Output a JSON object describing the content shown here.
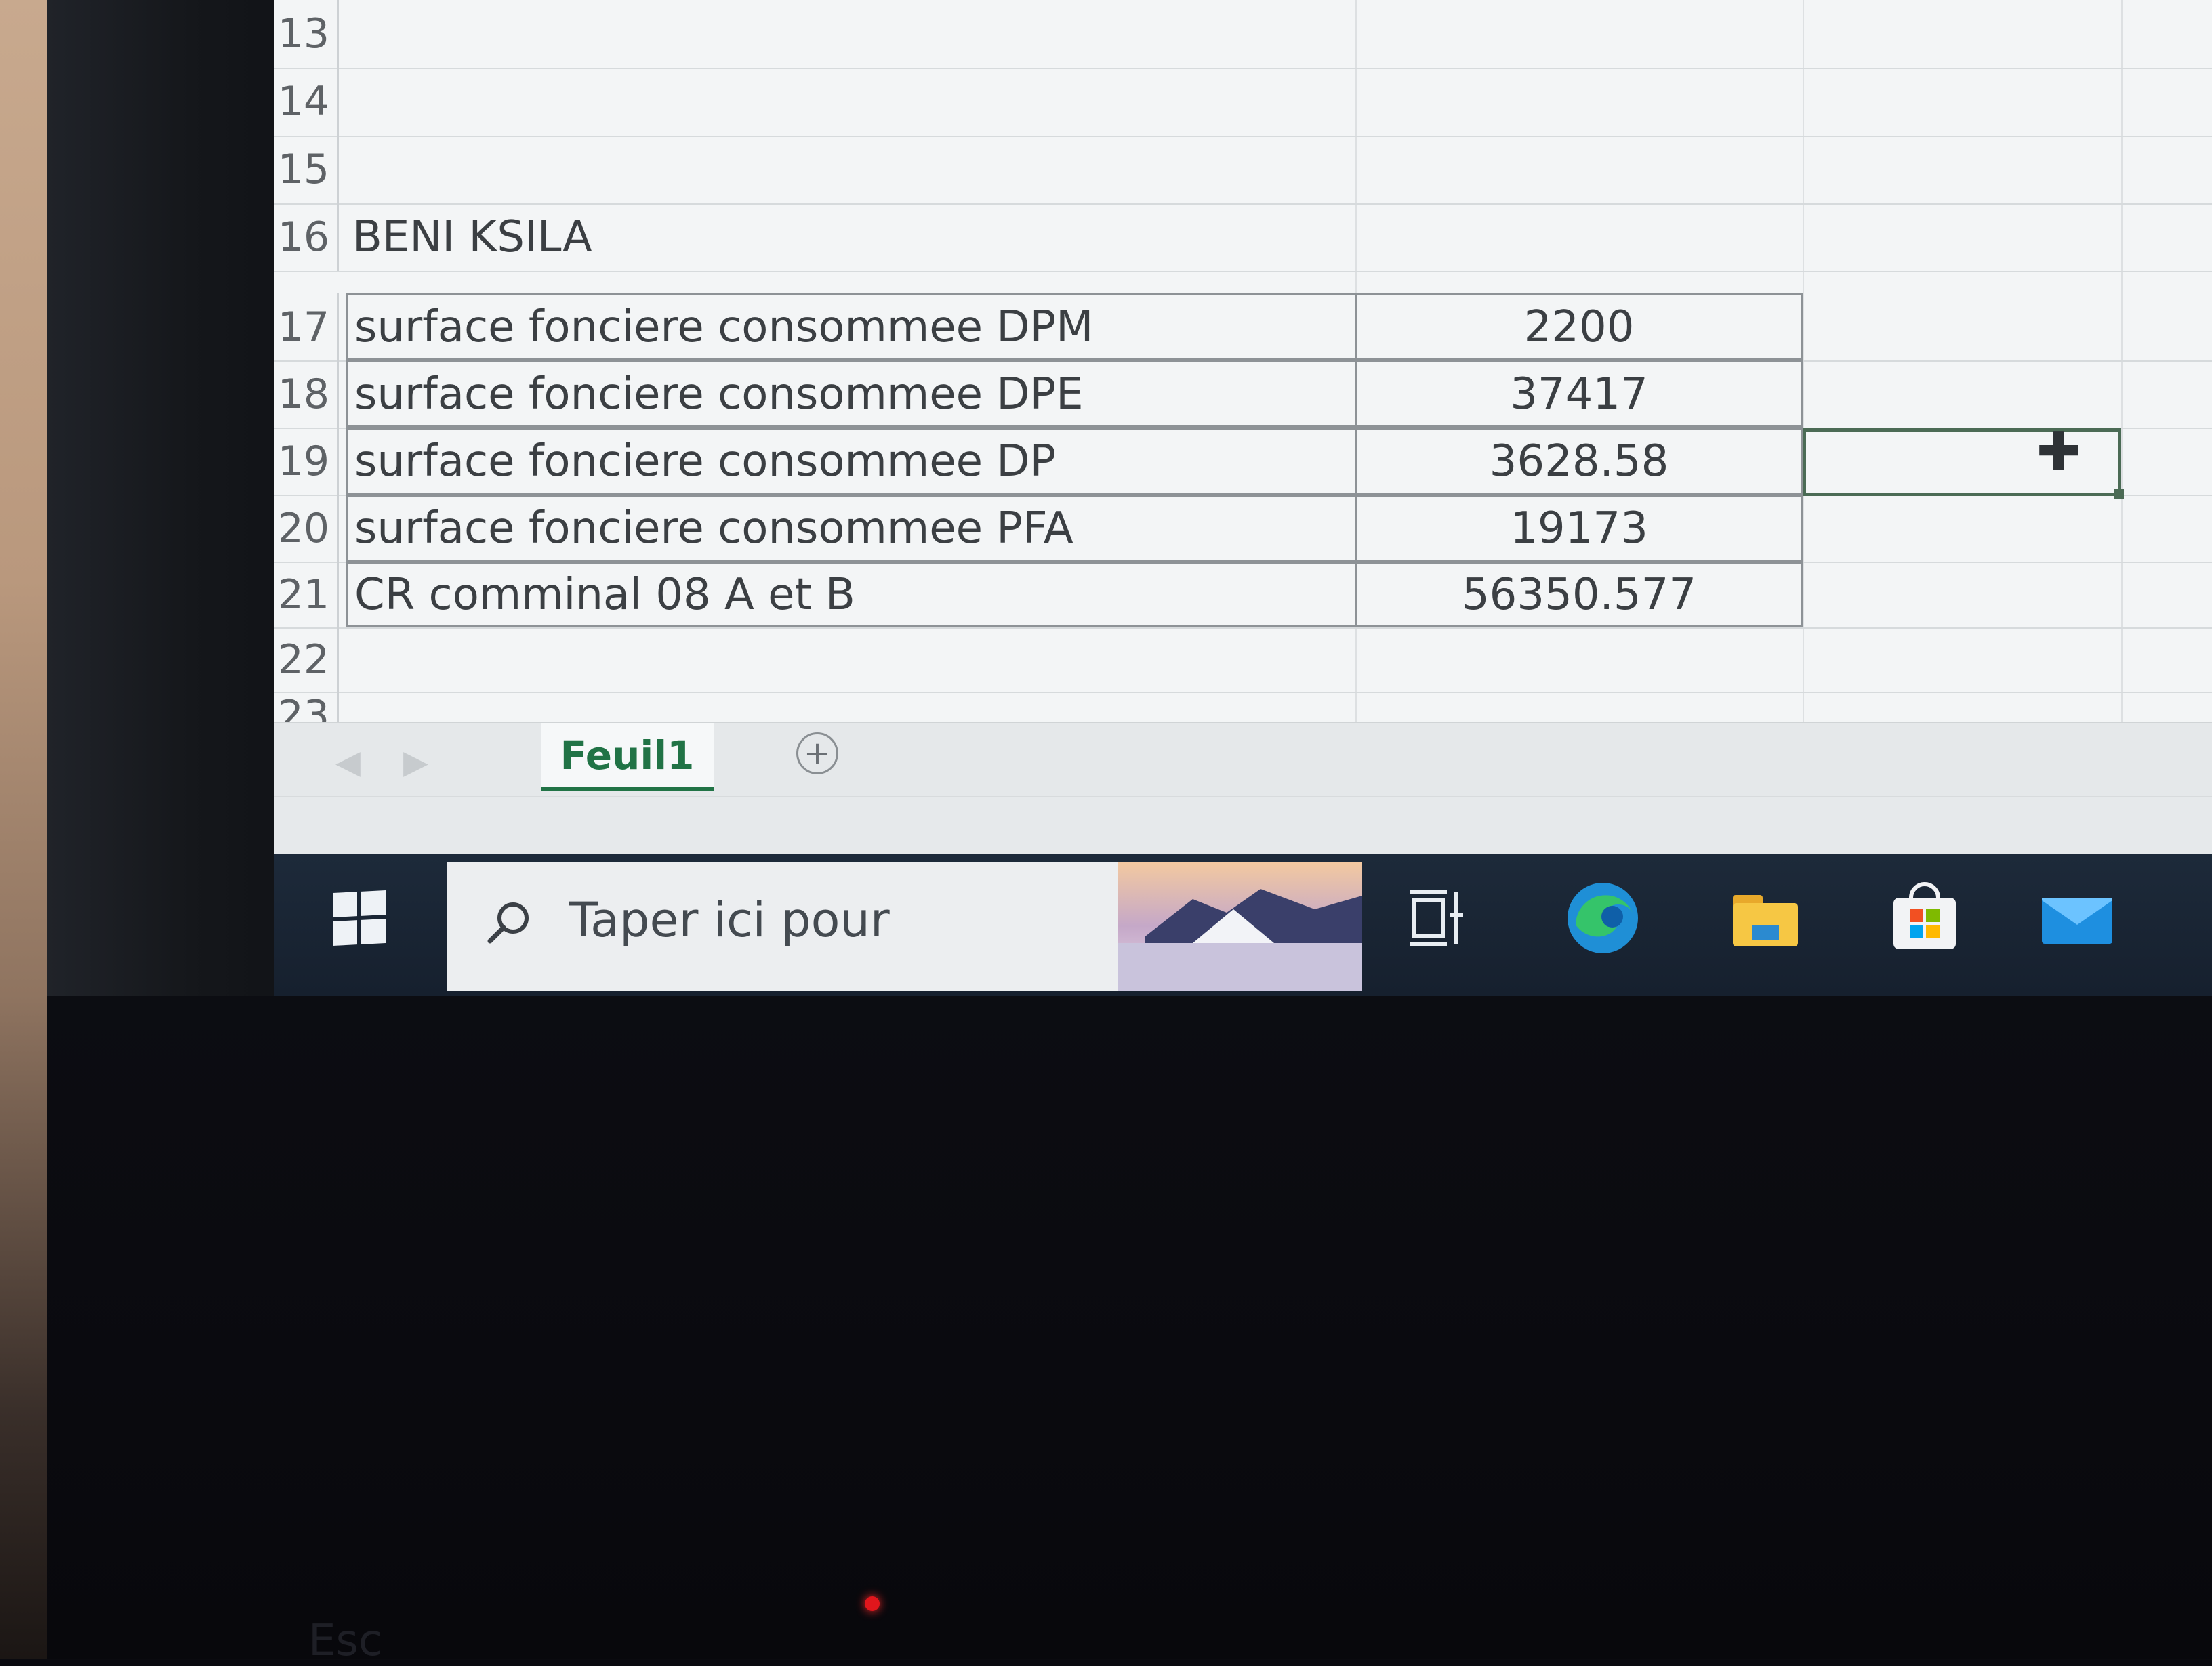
{
  "spreadsheet": {
    "rows": [
      {
        "num": "13",
        "a": "",
        "b": ""
      },
      {
        "num": "14",
        "a": "",
        "b": ""
      },
      {
        "num": "15",
        "a": "",
        "b": ""
      },
      {
        "num": "16",
        "a": "BENI KSILA",
        "b": ""
      },
      {
        "num": "17",
        "a": "surface fonciere consommee DPM",
        "b": "2200"
      },
      {
        "num": "18",
        "a": "surface fonciere consommee DPE",
        "b": "37417"
      },
      {
        "num": "19",
        "a": "surface fonciere consommee DP",
        "b": "3628.58"
      },
      {
        "num": "20",
        "a": "surface fonciere consommee PFA",
        "b": "19173"
      },
      {
        "num": "21",
        "a": "CR comminal  08 A et B",
        "b": "56350.577"
      },
      {
        "num": "22",
        "a": "",
        "b": ""
      },
      {
        "num": "23",
        "a": "",
        "b": ""
      }
    ],
    "sheet_tab": "Feuil1",
    "add_sheet_symbol": "+"
  },
  "taskbar": {
    "search_placeholder": "Taper ici pour",
    "icons": [
      "windows-start-icon",
      "search-icon",
      "task-view-icon",
      "edge-browser-icon",
      "file-explorer-icon",
      "microsoft-store-icon",
      "mail-icon"
    ]
  },
  "keyboard": {
    "esc_label": "Esc"
  },
  "colors": {
    "excel_green": "#217346",
    "taskbar_bg": "#16202e",
    "grid_bg": "#f3f5f6"
  }
}
